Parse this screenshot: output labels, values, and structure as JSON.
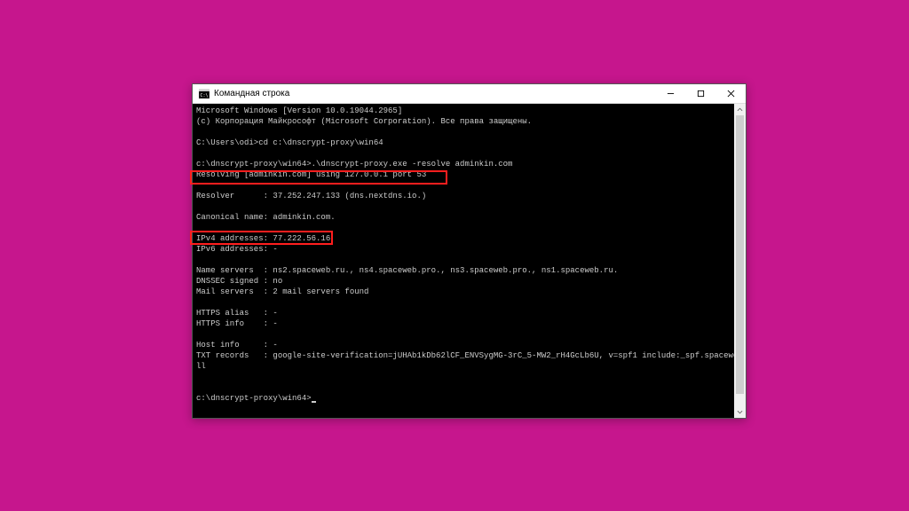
{
  "window": {
    "title": "Командная строка"
  },
  "terminal": {
    "line1": "Microsoft Windows [Version 10.0.19044.2965]",
    "line2": "(c) Корпорация Майкрософт (Microsoft Corporation). Все права защищены.",
    "blank": "",
    "prompt1": "C:\\Users\\odi>cd c:\\dnscrypt-proxy\\win64",
    "prompt2": "c:\\dnscrypt-proxy\\win64>.\\dnscrypt-proxy.exe -resolve adminkin.com",
    "resolving": "Resolving [adminkin.com] using 127.0.0.1 port 53",
    "resolver": "Resolver      : 37.252.247.133 (dns.nextdns.io.)",
    "canonical": "Canonical name: adminkin.com.",
    "ipv4": "IPv4 addresses: 77.222.56.16",
    "ipv6": "IPv6 addresses: -",
    "nameservers": "Name servers  : ns2.spaceweb.ru., ns4.spaceweb.pro., ns3.spaceweb.pro., ns1.spaceweb.ru.",
    "dnssec": "DNSSEC signed : no",
    "mail": "Mail servers  : 2 mail servers found",
    "httpsalias": "HTTPS alias   : -",
    "httpsinfo": "HTTPS info    : -",
    "hostinfo": "Host info     : -",
    "txt1": "TXT records   : google-site-verification=jUHAb1kDb62lCF_ENVSygMG-3rC_5-MW2_rH4GcLb6U, v=spf1 include:_spf.spaceweb.ru ~a",
    "txt2": "ll",
    "prompt3": "c:\\dnscrypt-proxy\\win64>"
  }
}
